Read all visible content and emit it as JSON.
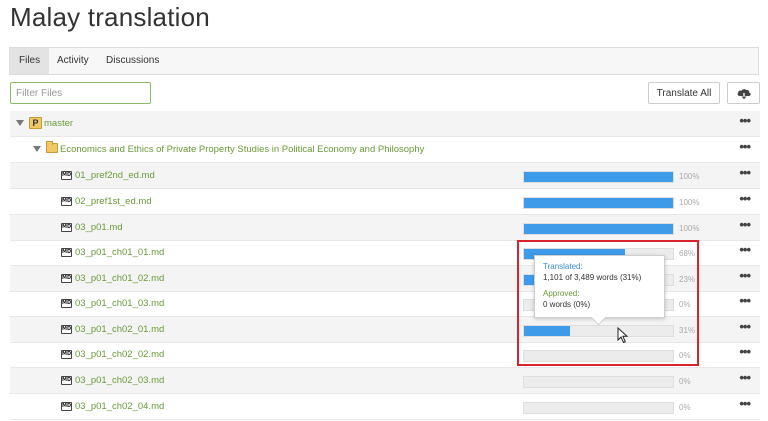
{
  "page": {
    "title": "Malay translation"
  },
  "tabs": [
    {
      "label": "Files",
      "active": true
    },
    {
      "label": "Activity",
      "active": false
    },
    {
      "label": "Discussions",
      "active": false
    }
  ],
  "toolbar": {
    "filter_placeholder": "Filter Files",
    "translate_all_label": "Translate All",
    "upload_icon": "cloud-upload-icon"
  },
  "tree": {
    "branch": {
      "icon": "branch-icon",
      "label": "master"
    },
    "folder": {
      "icon": "folder-icon",
      "label": "Economics and Ethics of Private Property Studies in Political Economy and Philosophy"
    },
    "files": [
      {
        "name": "01_pref2nd_ed.md",
        "progress": 100,
        "label": "100%"
      },
      {
        "name": "02_pref1st_ed.md",
        "progress": 100,
        "label": "100%"
      },
      {
        "name": "03_p01.md",
        "progress": 100,
        "label": "100%"
      },
      {
        "name": "03_p01_ch01_01.md",
        "progress": 68,
        "label": "68%"
      },
      {
        "name": "03_p01_ch01_02.md",
        "progress": 23,
        "label": "23%"
      },
      {
        "name": "03_p01_ch01_03.md",
        "progress": 0,
        "label": "0%"
      },
      {
        "name": "03_p01_ch02_01.md",
        "progress": 31,
        "label": "31%"
      },
      {
        "name": "03_p01_ch02_02.md",
        "progress": 0,
        "label": "0%"
      },
      {
        "name": "03_p01_ch02_03.md",
        "progress": 0,
        "label": "0%"
      },
      {
        "name": "03_p01_ch02_04.md",
        "progress": 0,
        "label": "0%"
      }
    ],
    "more_label": "•••"
  },
  "tooltip": {
    "translated_label": "Translated:",
    "translated_value": "1,101 of 3,489 words (31%)",
    "approved_label": "Approved:",
    "approved_value": "0 words (0%)"
  },
  "colors": {
    "accent": "#3d9be9",
    "link": "#6a9a3a",
    "highlight": "#d9232d"
  }
}
